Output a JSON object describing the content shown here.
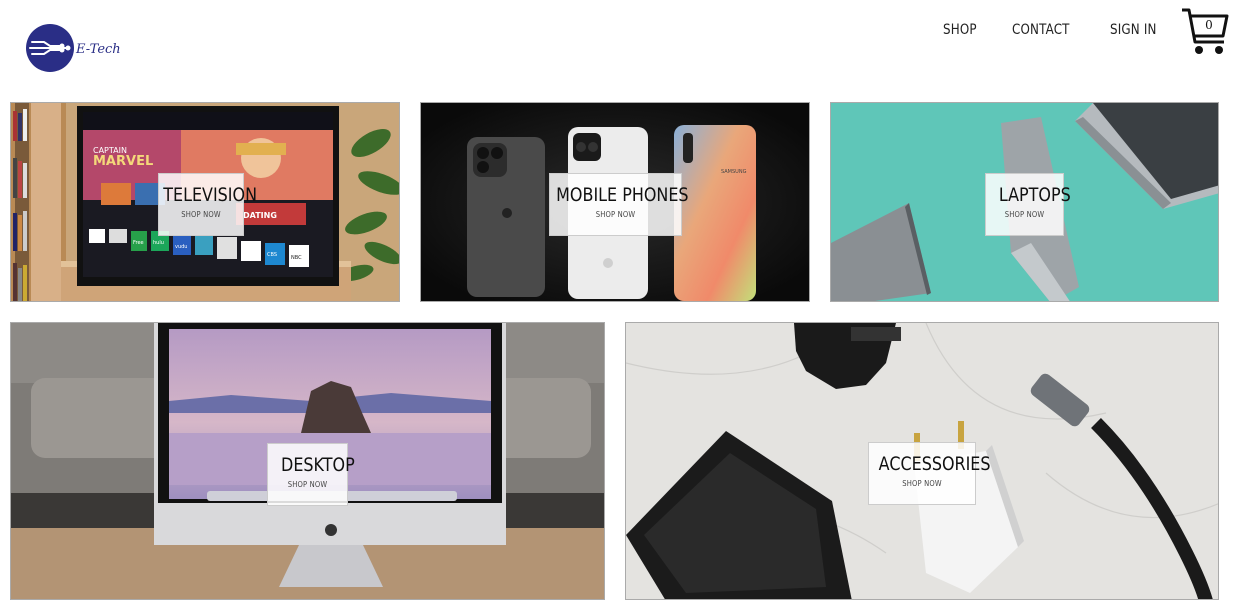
{
  "brand": {
    "name": "E-Tech",
    "color": "#2a2e86"
  },
  "nav": [
    {
      "label": "SHOP"
    },
    {
      "label": "CONTACT"
    },
    {
      "label": "SIGN IN"
    }
  ],
  "cart": {
    "count": "0",
    "icon": "cart-icon"
  },
  "categories": [
    {
      "title": "TELEVISION",
      "cta": "SHOP NOW"
    },
    {
      "title": "MOBILE PHONES",
      "cta": "SHOP NOW"
    },
    {
      "title": "LAPTOPS",
      "cta": "SHOP NOW"
    },
    {
      "title": "DESKTOP",
      "cta": "SHOP NOW"
    },
    {
      "title": "ACCESSORIES",
      "cta": "SHOP NOW"
    }
  ],
  "tv_screen": {
    "hero": "CAPTAIN MARVEL",
    "apps": [
      "Free",
      "hulu",
      "vudu",
      "CBS",
      "NBC"
    ],
    "promo": "DATING"
  }
}
